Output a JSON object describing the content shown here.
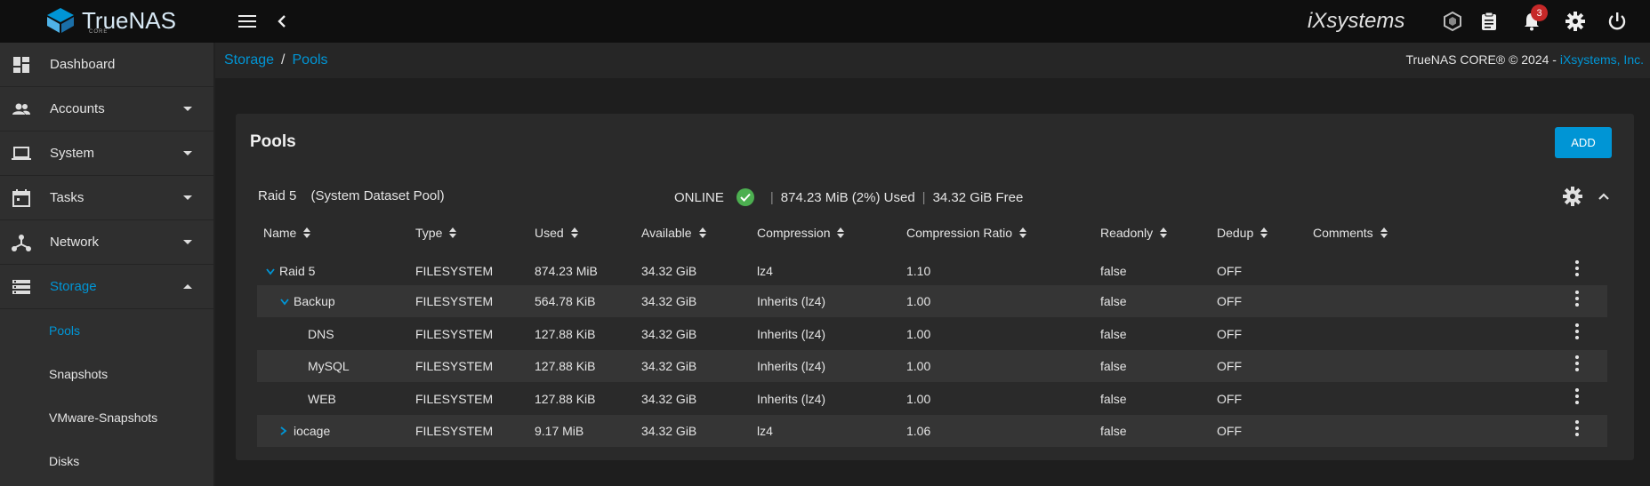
{
  "topbar": {
    "logo_text": "TrueNAS",
    "logo_sub": "CORE",
    "ix_text": "iXsystems",
    "notifications_count": "3"
  },
  "sidebar": {
    "items": [
      {
        "label": "Dashboard",
        "icon": "dashboard-icon"
      },
      {
        "label": "Accounts",
        "icon": "people-icon"
      },
      {
        "label": "System",
        "icon": "laptop-icon"
      },
      {
        "label": "Tasks",
        "icon": "calendar-icon"
      },
      {
        "label": "Network",
        "icon": "network-icon"
      },
      {
        "label": "Storage",
        "icon": "storage-icon"
      }
    ],
    "subitems": [
      "Pools",
      "Snapshots",
      "VMware-Snapshots",
      "Disks"
    ]
  },
  "breadcrumb": {
    "parent": "Storage",
    "current": "Pools"
  },
  "copyright": {
    "text": "TrueNAS CORE® © 2024 - ",
    "link": "iXsystems, Inc."
  },
  "card": {
    "title": "Pools",
    "add_label": "ADD",
    "pool_name": "Raid 5",
    "pool_note": "(System Dataset Pool)",
    "status": "ONLINE",
    "used": "874.23 MiB (2%) Used",
    "free": "34.32 GiB Free"
  },
  "table": {
    "headers": [
      "Name",
      "Type",
      "Used",
      "Available",
      "Compression",
      "Compression Ratio",
      "Readonly",
      "Dedup",
      "Comments"
    ],
    "rows": [
      {
        "name": "Raid 5",
        "type": "FILESYSTEM",
        "used": "874.23 MiB",
        "available": "34.32 GiB",
        "compression": "lz4",
        "ratio": "1.10",
        "readonly": "false",
        "dedup": "OFF"
      },
      {
        "name": "Backup",
        "type": "FILESYSTEM",
        "used": "564.78 KiB",
        "available": "34.32 GiB",
        "compression": "Inherits (lz4)",
        "ratio": "1.00",
        "readonly": "false",
        "dedup": "OFF"
      },
      {
        "name": "DNS",
        "type": "FILESYSTEM",
        "used": "127.88 KiB",
        "available": "34.32 GiB",
        "compression": "Inherits (lz4)",
        "ratio": "1.00",
        "readonly": "false",
        "dedup": "OFF"
      },
      {
        "name": "MySQL",
        "type": "FILESYSTEM",
        "used": "127.88 KiB",
        "available": "34.32 GiB",
        "compression": "Inherits (lz4)",
        "ratio": "1.00",
        "readonly": "false",
        "dedup": "OFF"
      },
      {
        "name": "WEB",
        "type": "FILESYSTEM",
        "used": "127.88 KiB",
        "available": "34.32 GiB",
        "compression": "Inherits (lz4)",
        "ratio": "1.00",
        "readonly": "false",
        "dedup": "OFF"
      },
      {
        "name": "iocage",
        "type": "FILESYSTEM",
        "used": "9.17 MiB",
        "available": "34.32 GiB",
        "compression": "lz4",
        "ratio": "1.06",
        "readonly": "false",
        "dedup": "OFF"
      }
    ]
  },
  "colors": {
    "accent": "#0095d5",
    "ok": "#4caf50",
    "badge": "#c62828"
  }
}
